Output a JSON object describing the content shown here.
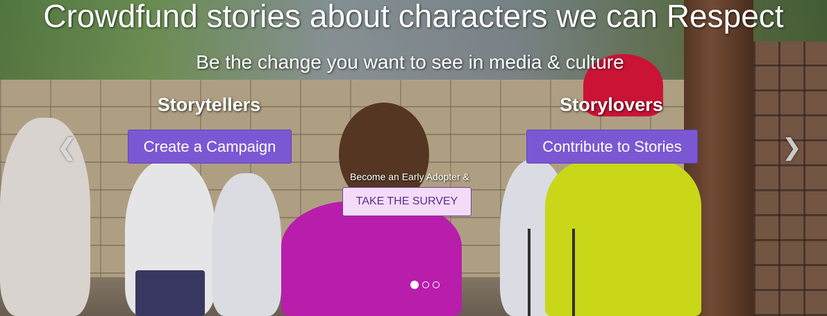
{
  "hero": {
    "title": "Crowdfund stories about characters we can Respect",
    "subtitle": "Be the change you want to see in media & culture"
  },
  "storytellers": {
    "heading": "Storytellers",
    "button_label": "Create a Campaign"
  },
  "storylovers": {
    "heading": "Storylovers",
    "button_label": "Contribute to Stories"
  },
  "survey": {
    "note": "Become an Early Adopter &",
    "button_label": "TAKE THE SURVEY"
  },
  "carousel": {
    "prev_icon": "chevron-left-icon",
    "next_icon": "chevron-right-icon",
    "prev_glyph": "❮",
    "next_glyph": "❯",
    "slide_count": 3,
    "active_index": 0
  },
  "colors": {
    "primary_button": "#7b58d3",
    "survey_button_bg": "#f4dcf8",
    "survey_button_text": "#5b2d8e"
  }
}
